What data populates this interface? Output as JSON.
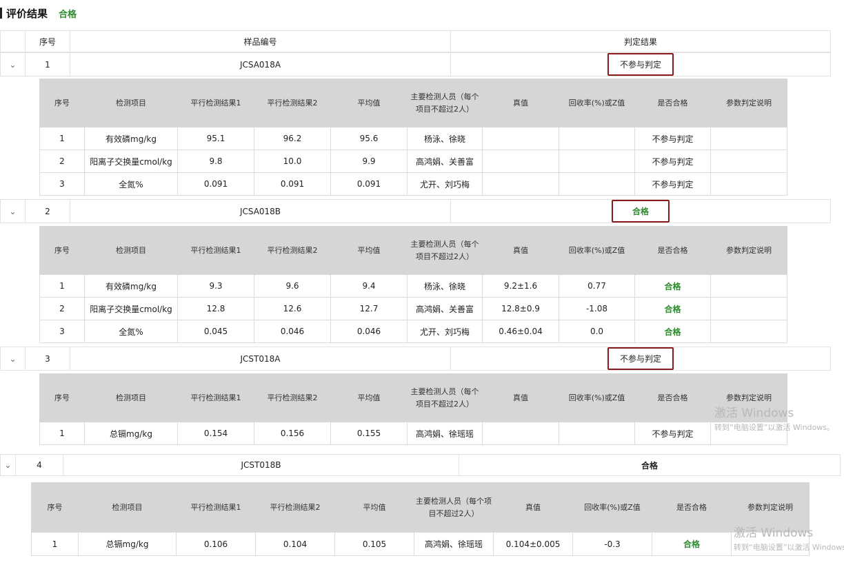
{
  "header": {
    "title": "评价结果",
    "status": "合格"
  },
  "outer_headers": {
    "seq": "序号",
    "sample_no": "样品编号",
    "judgement": "判定结果"
  },
  "inner_headers": {
    "seq": "序号",
    "item": "检测项目",
    "par1": "平行检测结果1",
    "par2": "平行检测结果2",
    "avg": "平均值",
    "staff": "主要检测人员（每个项目不超过2人）",
    "true": "真值",
    "recovery": "回收率(%)或Z值",
    "qualified": "是否合格",
    "note": "参数判定说明"
  },
  "samples": [
    {
      "seq": "1",
      "sample_no": "JCSA018A",
      "judgement": "不参与判定",
      "rows": [
        {
          "seq": "1",
          "item": "有效磷mg/kg",
          "par1": "95.1",
          "par2": "96.2",
          "avg": "95.6",
          "staff": "杨泳、徐晓",
          "true": "",
          "recovery": "",
          "qualified": "不参与判定",
          "note": ""
        },
        {
          "seq": "2",
          "item": "阳离子交换量cmol/kg",
          "par1": "9.8",
          "par2": "10.0",
          "avg": "9.9",
          "staff": "高鸿娟、关善富",
          "true": "",
          "recovery": "",
          "qualified": "不参与判定",
          "note": ""
        },
        {
          "seq": "3",
          "item": "全氮%",
          "par1": "0.091",
          "par2": "0.091",
          "avg": "0.091",
          "staff": "尤开、刘巧梅",
          "true": "",
          "recovery": "",
          "qualified": "不参与判定",
          "note": ""
        }
      ]
    },
    {
      "seq": "2",
      "sample_no": "JCSA018B",
      "judgement": "合格",
      "rows": [
        {
          "seq": "1",
          "item": "有效磷mg/kg",
          "par1": "9.3",
          "par2": "9.6",
          "avg": "9.4",
          "staff": "杨泳、徐晓",
          "true": "9.2±1.6",
          "recovery": "0.77",
          "qualified": "合格",
          "note": ""
        },
        {
          "seq": "2",
          "item": "阳离子交换量cmol/kg",
          "par1": "12.8",
          "par2": "12.6",
          "avg": "12.7",
          "staff": "高鸿娟、关善富",
          "true": "12.8±0.9",
          "recovery": "-1.08",
          "qualified": "合格",
          "note": ""
        },
        {
          "seq": "3",
          "item": "全氮%",
          "par1": "0.045",
          "par2": "0.046",
          "avg": "0.046",
          "staff": "尤开、刘巧梅",
          "true": "0.46±0.04",
          "recovery": "0.0",
          "qualified": "合格",
          "note": ""
        }
      ]
    },
    {
      "seq": "3",
      "sample_no": "JCST018A",
      "judgement": "不参与判定",
      "rows": [
        {
          "seq": "1",
          "item": "总镉mg/kg",
          "par1": "0.154",
          "par2": "0.156",
          "avg": "0.155",
          "staff": "高鸿娟、徐瑶瑶",
          "true": "",
          "recovery": "",
          "qualified": "不参与判定",
          "note": ""
        }
      ]
    },
    {
      "seq": "4",
      "sample_no": "JCST018B",
      "judgement": "合格",
      "rows": [
        {
          "seq": "1",
          "item": "总镉mg/kg",
          "par1": "0.106",
          "par2": "0.104",
          "avg": "0.105",
          "staff": "高鸿娟、徐瑶瑶",
          "true": "0.104±0.005",
          "recovery": "-0.3",
          "qualified": "合格",
          "note": ""
        }
      ]
    }
  ],
  "watermark": {
    "line1": "激活 Windows",
    "line2": "转到“电脑设置”以激活 Windows。"
  },
  "colors": {
    "pass": "#2e8b2e",
    "highlight_box": "#8b1a1a",
    "inner_header_bg": "#d6d6d6"
  }
}
